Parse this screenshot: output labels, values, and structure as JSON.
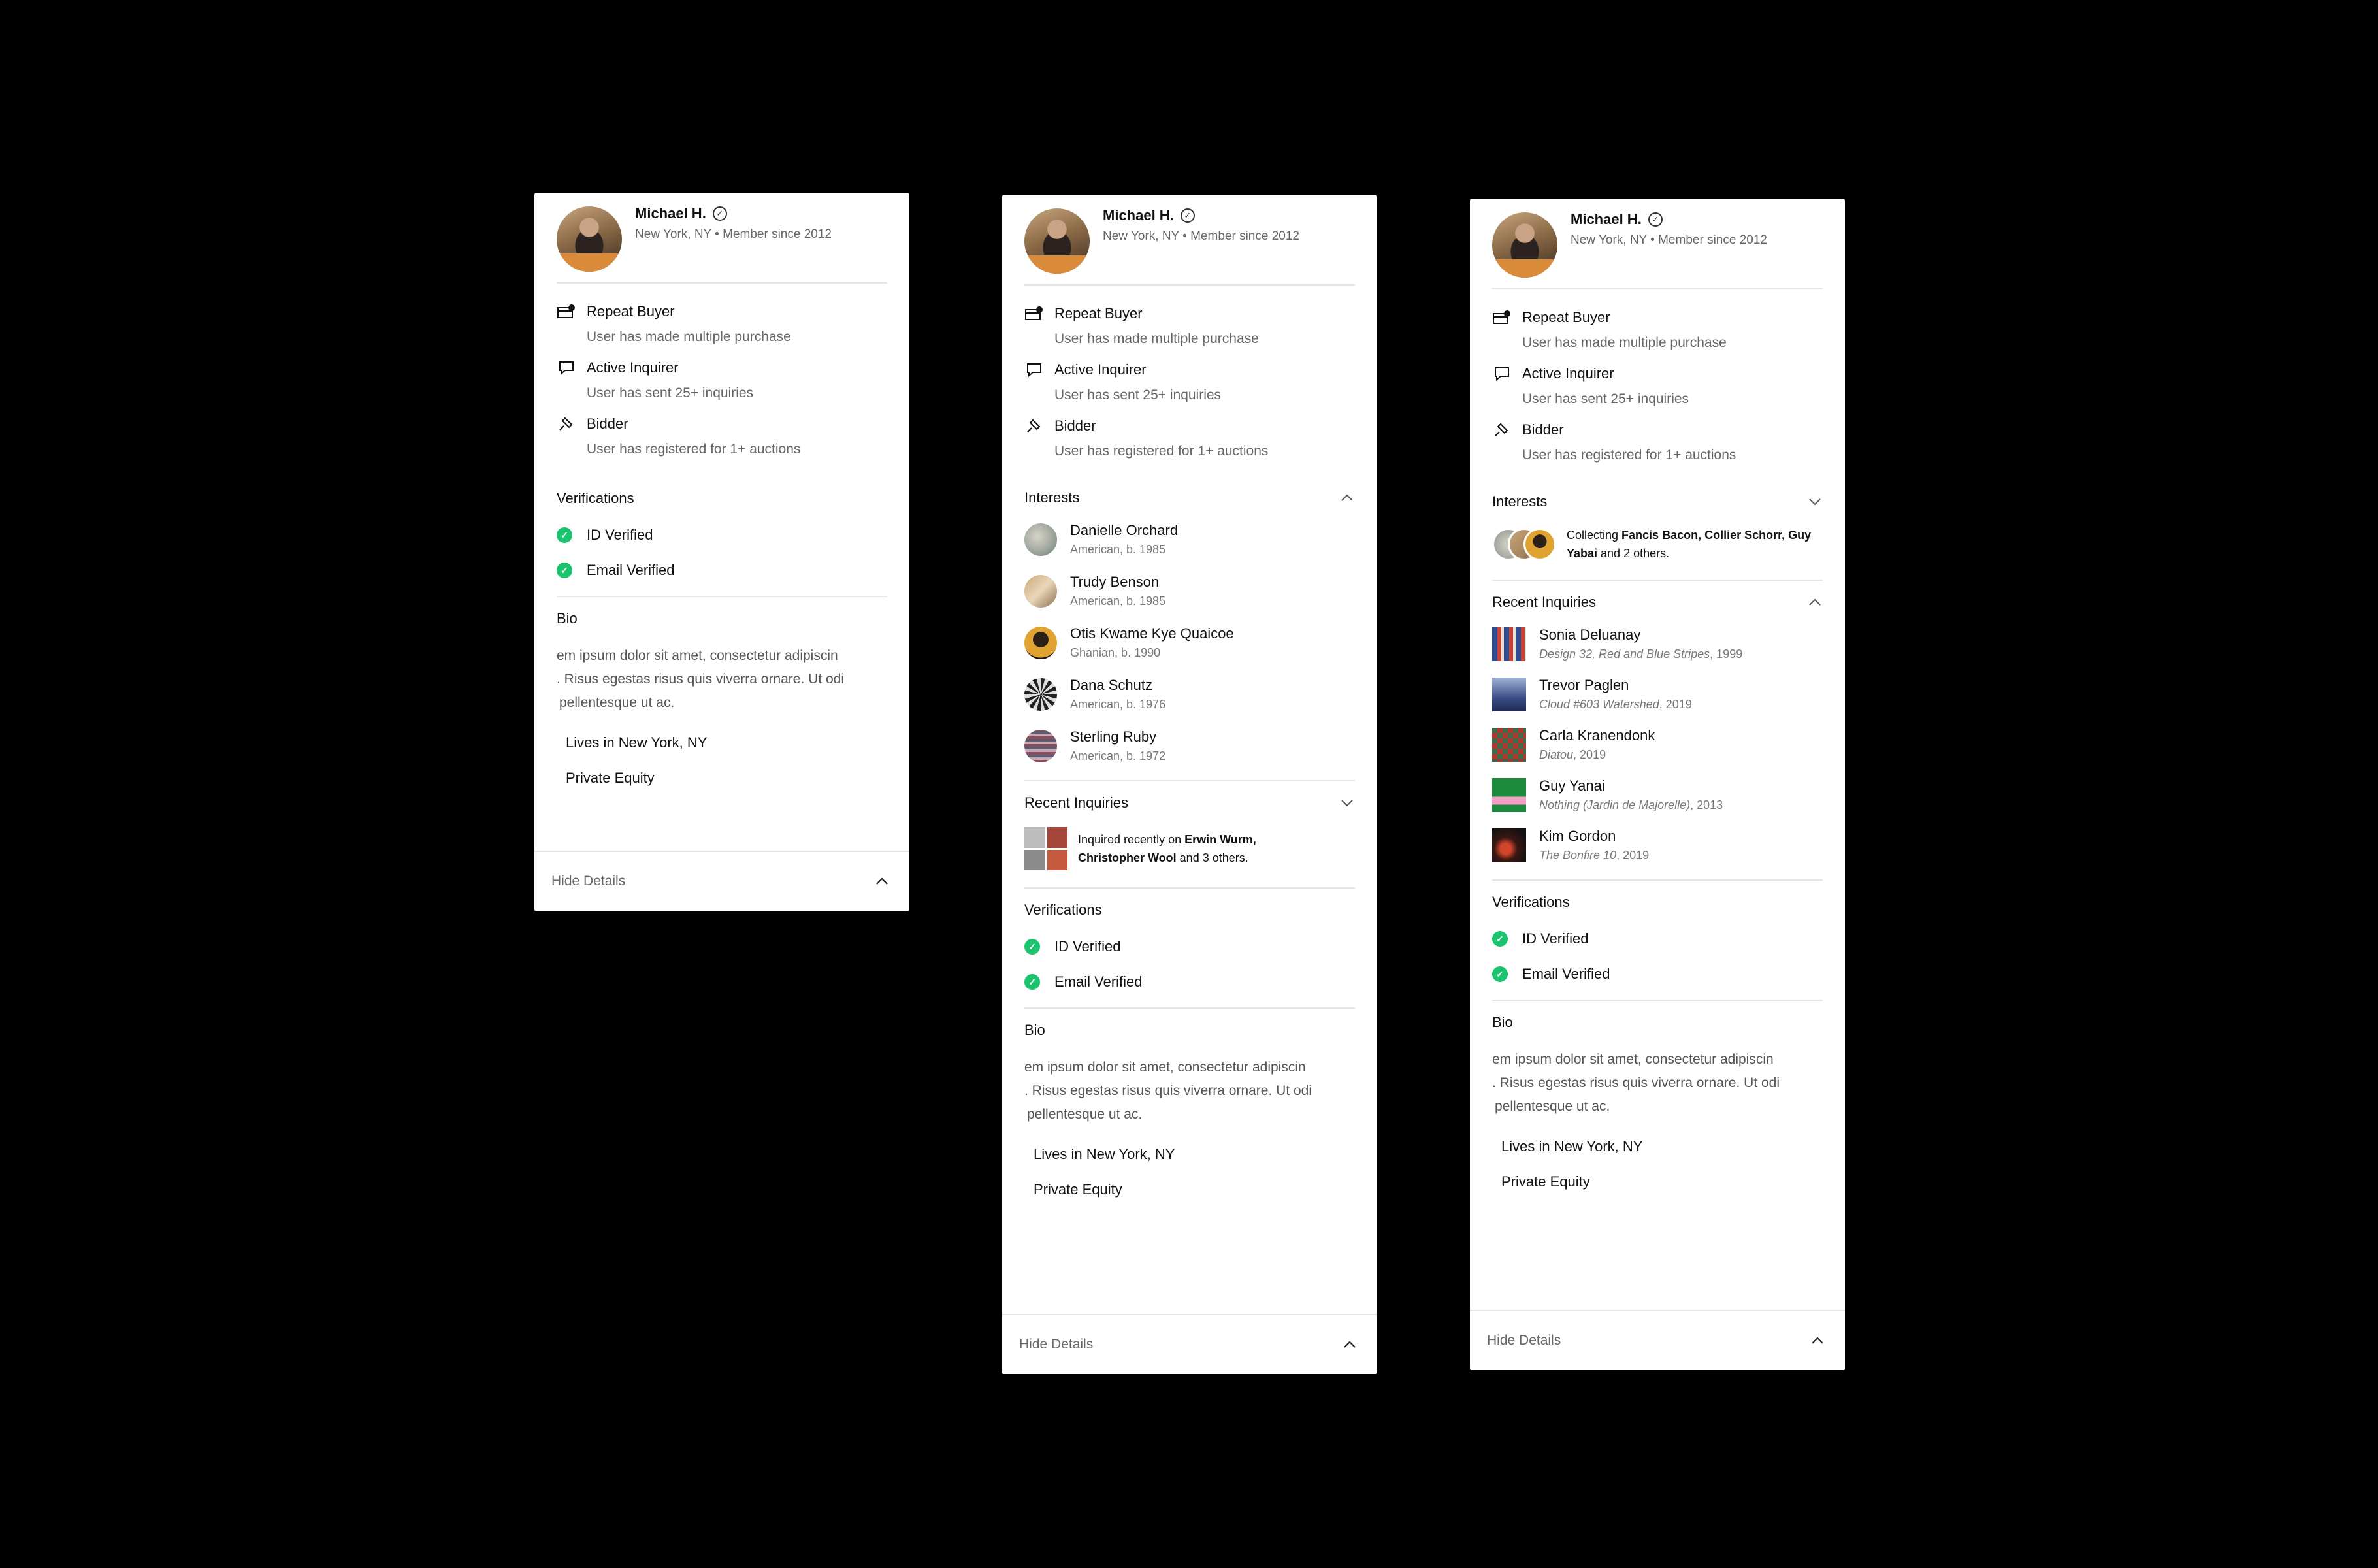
{
  "profile": {
    "name": "Michael H.",
    "location": "New York, NY",
    "member_since": "Member since 2012",
    "separator": "•"
  },
  "badges": [
    {
      "icon": "wallet-icon",
      "title": "Repeat Buyer",
      "desc": "User has made multiple purchase"
    },
    {
      "icon": "chat-icon",
      "title": "Active Inquirer",
      "desc": "User has sent 25+ inquiries"
    },
    {
      "icon": "gavel-icon",
      "title": "Bidder",
      "desc": "User has registered for 1+ auctions"
    }
  ],
  "verifications": {
    "title": "Verifications",
    "items": [
      "ID Verified",
      "Email Verified"
    ]
  },
  "bio": {
    "title": "Bio",
    "line1": "em ipsum dolor sit amet, consectetur adipiscin",
    "line2": ". Risus egestas risus quis viverra ornare. Ut odi",
    "line3": "pellentesque ut ac.",
    "lives": "Lives in New York, NY",
    "profession": "Private Equity"
  },
  "footer": {
    "label": "Hide Details"
  },
  "interests": {
    "title": "Interests",
    "artists": [
      {
        "name": "Danielle Orchard",
        "meta": "American, b. 1985"
      },
      {
        "name": "Trudy Benson",
        "meta": "American, b. 1985"
      },
      {
        "name": "Otis Kwame Kye Quaicoe",
        "meta": "Ghanian, b. 1990"
      },
      {
        "name": "Dana Schutz",
        "meta": "American, b. 1976"
      },
      {
        "name": "Sterling Ruby",
        "meta": "American, b. 1972"
      }
    ],
    "summary": {
      "prefix": "Collecting ",
      "names": "Fancis Bacon, Collier Schorr, Guy Yabai",
      "suffix": " and 2 others."
    }
  },
  "recent_inquiries": {
    "title": "Recent Inquiries",
    "summary": {
      "prefix": "Inquired recently on ",
      "names1": "Erwin Wurm,",
      "names2": "Christopher Wool",
      "suffix": " and 3 others."
    },
    "items": [
      {
        "artist": "Sonia Deluanay",
        "work": "Design 32, Red and Blue Stripes",
        "year": ", 1999"
      },
      {
        "artist": "Trevor Paglen",
        "work": "Cloud #603 Watershed",
        "year": ", 2019"
      },
      {
        "artist": "Carla Kranendonk",
        "work": "Diatou",
        "year": ", 2019"
      },
      {
        "artist": "Guy Yanai",
        "work": "Nothing (Jardin de Majorelle)",
        "year": ", 2013"
      },
      {
        "artist": "Kim Gordon",
        "work": "The Bonfire 10",
        "year": ", 2019"
      }
    ]
  },
  "colors": {
    "verified_green": "#1bc36c",
    "text_primary": "#111111",
    "text_secondary": "#666666",
    "divider": "#e5e5e5"
  }
}
